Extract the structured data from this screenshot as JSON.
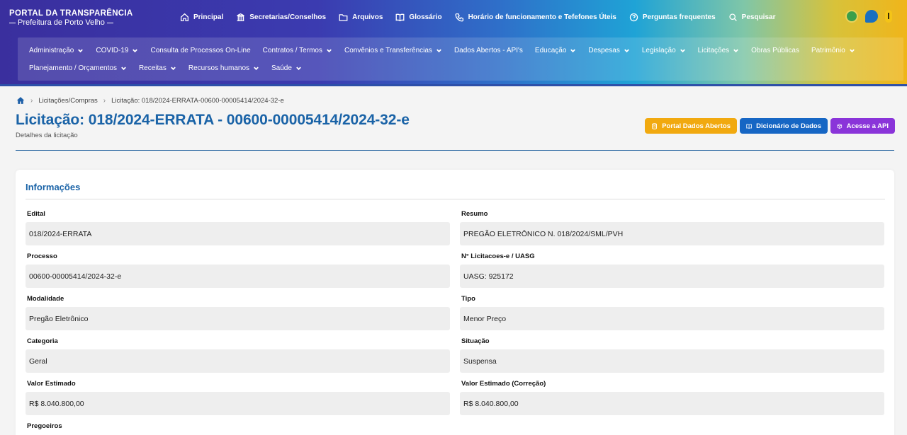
{
  "header": {
    "logo_line1": "PORTAL DA TRANSPARÊNCIA",
    "logo_line2": "Prefeitura de Porto Velho",
    "top_nav": [
      {
        "label": "Principal",
        "icon": "home-icon"
      },
      {
        "label": "Secretarias/Conselhos",
        "icon": "building-icon"
      },
      {
        "label": "Arquivos",
        "icon": "folder-icon"
      },
      {
        "label": "Glossário",
        "icon": "book-icon"
      },
      {
        "label": "Horário de funcionamento e Tefefones Úteis",
        "icon": "phone-icon"
      },
      {
        "label": "Perguntas frequentes",
        "icon": "help-icon"
      },
      {
        "label": "Pesquisar",
        "icon": "search-icon"
      }
    ]
  },
  "menu": {
    "row1": [
      {
        "label": "Administração",
        "dropdown": true
      },
      {
        "label": "COVID-19",
        "dropdown": true
      },
      {
        "label": "Consulta de Processos On-Line",
        "dropdown": false
      },
      {
        "label": "Contratos / Termos",
        "dropdown": true
      },
      {
        "label": "Convênios e Transferências",
        "dropdown": true
      },
      {
        "label": "Dados Abertos - API's",
        "dropdown": false
      },
      {
        "label": "Educação",
        "dropdown": true
      },
      {
        "label": "Despesas",
        "dropdown": true
      },
      {
        "label": "Legislação",
        "dropdown": true
      },
      {
        "label": "Licitações",
        "dropdown": true
      },
      {
        "label": "Obras Públicas",
        "dropdown": false
      },
      {
        "label": "Patrimônio",
        "dropdown": true
      }
    ],
    "row2": [
      {
        "label": "Planejamento / Orçamentos",
        "dropdown": true
      },
      {
        "label": "Receitas",
        "dropdown": true
      },
      {
        "label": "Recursos humanos",
        "dropdown": true
      },
      {
        "label": "Saúde",
        "dropdown": true
      }
    ]
  },
  "breadcrumb": {
    "items": [
      "Licitações/Compras",
      "Licitação: 018/2024-ERRATA-00600-00005414/2024-32-e"
    ]
  },
  "page": {
    "title": "Licitação: 018/2024-ERRATA - 00600-00005414/2024-32-e",
    "subtitle": "Detalhes da licitação"
  },
  "actions": {
    "portal": "Portal Dados Abertos",
    "dicionario": "Dicionário de Dados",
    "api": "Acesse a API"
  },
  "info": {
    "title": "Informações",
    "fields": {
      "edital": {
        "label": "Edital",
        "value": "018/2024-ERRATA"
      },
      "resumo": {
        "label": "Resumo",
        "value": "PREGÃO ELETRÔNICO N. 018/2024/SML/PVH"
      },
      "processo": {
        "label": "Processo",
        "value": "00600-00005414/2024-32-e"
      },
      "uasg": {
        "label": "N° Licitacoes-e / UASG",
        "value": "UASG: 925172"
      },
      "modalidade": {
        "label": "Modalidade",
        "value": "Pregão Eletrônico"
      },
      "tipo": {
        "label": "Tipo",
        "value": "Menor Preço"
      },
      "categoria": {
        "label": "Categoria",
        "value": "Geral"
      },
      "situacao": {
        "label": "Situação",
        "value": "Suspensa"
      },
      "valor": {
        "label": "Valor Estimado",
        "value": "R$ 8.040.800,00"
      },
      "valor_corr": {
        "label": "Valor Estimado (Correção)",
        "value": "R$ 8.040.800,00"
      },
      "pregoeiros": {
        "label": "Pregoeiros"
      }
    }
  }
}
